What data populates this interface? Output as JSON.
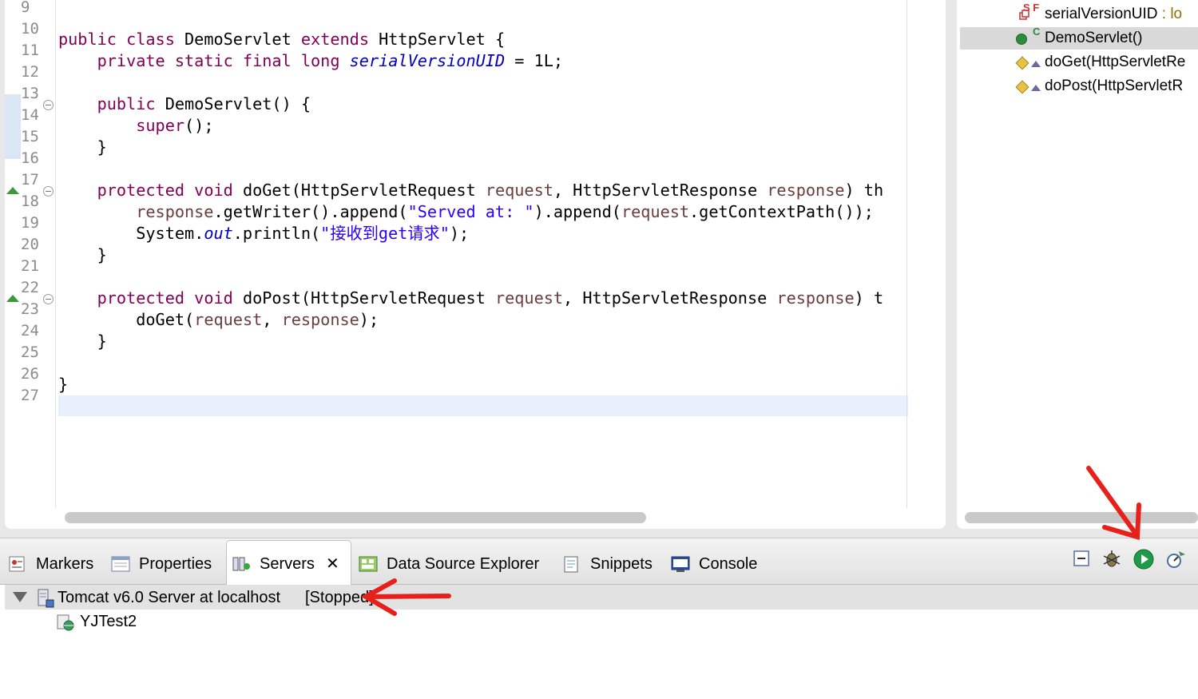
{
  "editor": {
    "line_numbers": [
      "9",
      "10",
      "11",
      "12",
      "13",
      "14",
      "15",
      "16",
      "17",
      "18",
      "19",
      "20",
      "21",
      "22",
      "23",
      "24",
      "25",
      "26",
      "27"
    ],
    "line10": {
      "kw1": "public",
      "kw2": "class",
      "name": "DemoServlet",
      "kw3": "extends",
      "rest": "HttpServlet {"
    },
    "line11": {
      "kw": "private static final long",
      "field": "serialVersionUID",
      "rest": "= 1L;"
    },
    "line13": {
      "kw": "public",
      "rest": "DemoServlet() {"
    },
    "line14": {
      "kw": "super",
      "rest": "();"
    },
    "line15": "}",
    "line17": {
      "kw": "protected void",
      "p1": "doGet(HttpServletRequest ",
      "a1": "request",
      "p2": ", HttpServletResponse ",
      "a2": "response",
      "p3": ") th"
    },
    "line18": {
      "a": "response",
      "p1": ".getWriter().append(",
      "s": "\"Served at: \"",
      "p2": ").append(",
      "a2": "request",
      "p3": ".getContextPath());"
    },
    "line19": {
      "p1": "System.",
      "st": "out",
      "p2": ".println(",
      "s": "\"接收到get请求\"",
      "p3": ");"
    },
    "line20": "}",
    "line22": {
      "kw": "protected void",
      "p1": "doPost(HttpServletRequest ",
      "a1": "request",
      "p2": ", HttpServletResponse ",
      "a2": "response",
      "p3": ") t"
    },
    "line23": {
      "p1": "doGet(",
      "a1": "request",
      "p2": ", ",
      "a2": "response",
      "p3": ");"
    },
    "line24": "}",
    "line26": "}"
  },
  "outline": {
    "items": [
      {
        "label": "serialVersionUID",
        "suffix": " : lo",
        "badge": "S F"
      },
      {
        "label": "DemoServlet()",
        "badge": "C"
      },
      {
        "label": "doGet(HttpServletRe"
      },
      {
        "label": "doPost(HttpServletR"
      }
    ]
  },
  "bottom": {
    "tabs": [
      {
        "label": "Markers",
        "icon": "markers-icon"
      },
      {
        "label": "Properties",
        "icon": "properties-icon"
      },
      {
        "label": "Servers",
        "icon": "servers-icon"
      },
      {
        "label": "Data Source Explorer",
        "icon": "data-source-icon"
      },
      {
        "label": "Snippets",
        "icon": "snippets-icon"
      },
      {
        "label": "Console",
        "icon": "console-icon"
      }
    ],
    "close_glyph": "✕",
    "servers": {
      "server": "Tomcat v6.0 Server at localhost",
      "state": "[Stopped]",
      "child": "YJTest2"
    }
  },
  "colors": {
    "keyword": "#7f0055",
    "string": "#2a00ff",
    "field": "#0000c0",
    "arrow": "#e8201a",
    "start_button": "#1f9a4a"
  }
}
